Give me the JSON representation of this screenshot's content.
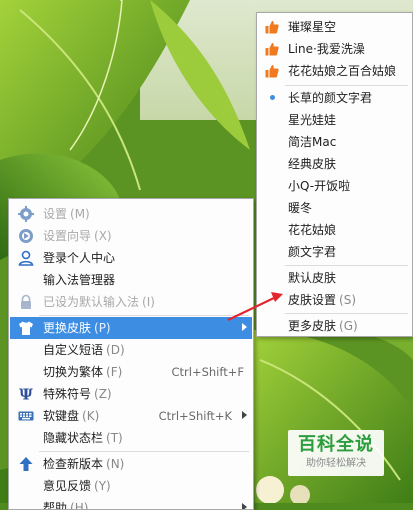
{
  "main_menu": {
    "items": [
      {
        "label": "设置",
        "hotkey": "(M)",
        "icon": "gear-icon",
        "state": "disabled"
      },
      {
        "label": "设置向导",
        "hotkey": "(X)",
        "icon": "wizard-icon",
        "state": "disabled"
      },
      {
        "label": "登录个人中心",
        "hotkey": "",
        "icon": "user-icon",
        "state": "normal"
      },
      {
        "label": "输入法管理器",
        "hotkey": "",
        "icon": "",
        "state": "normal"
      },
      {
        "label": "已设为默认输入法",
        "hotkey": "(I)",
        "icon": "lock-icon",
        "state": "disabled"
      },
      {
        "label": "更换皮肤",
        "hotkey": "(P)",
        "icon": "shirt-icon",
        "state": "highlighted",
        "submenu": true
      },
      {
        "label": "自定义短语",
        "hotkey": "(D)",
        "icon": "",
        "state": "normal"
      },
      {
        "label": "切换为繁体",
        "hotkey": "(F)",
        "icon": "",
        "state": "normal",
        "shortcut": "Ctrl+Shift+F"
      },
      {
        "label": "特殊符号",
        "hotkey": "(Z)",
        "icon": "psi-icon",
        "state": "normal"
      },
      {
        "label": "软键盘",
        "hotkey": "(K)",
        "icon": "keyboard-icon",
        "state": "normal",
        "shortcut": "Ctrl+Shift+K",
        "submenu": true
      },
      {
        "label": "隐藏状态栏",
        "hotkey": "(T)",
        "icon": "",
        "state": "normal"
      },
      {
        "label": "检查新版本",
        "hotkey": "(N)",
        "icon": "up-arrow-icon",
        "state": "normal"
      },
      {
        "label": "意见反馈",
        "hotkey": "(Y)",
        "icon": "",
        "state": "normal"
      },
      {
        "label": "帮助",
        "hotkey": "(H)",
        "icon": "",
        "state": "normal",
        "submenu": true
      }
    ]
  },
  "skin_menu": {
    "hot_items": [
      {
        "label": "璀璨星空",
        "icon": "thumbs-up-icon"
      },
      {
        "label": "Line·我爱洗澡",
        "icon": "thumbs-up-icon"
      },
      {
        "label": "花花姑娘之百合姑娘",
        "icon": "thumbs-up-icon"
      }
    ],
    "skins": [
      {
        "label": "长草的颜文字君",
        "selected": true
      },
      {
        "label": "星光娃娃",
        "selected": false
      },
      {
        "label": "简洁Mac",
        "selected": false
      },
      {
        "label": "经典皮肤",
        "selected": false
      },
      {
        "label": "小Q-开饭啦",
        "selected": false
      },
      {
        "label": "暖冬",
        "selected": false
      },
      {
        "label": "花花姑娘",
        "selected": false
      },
      {
        "label": "颜文字君",
        "selected": false
      }
    ],
    "default_skin": "默认皮肤",
    "skin_settings": {
      "label": "皮肤设置",
      "hotkey": "(S)"
    },
    "more_skins": {
      "label": "更多皮肤",
      "hotkey": "(G)"
    }
  },
  "watermark": {
    "title": "百科全说",
    "subtitle": "助你轻松解决"
  },
  "colors": {
    "highlight": "#3d8ee3",
    "thumbs": "#f07a1d",
    "annotation_arrow": "#e3262d",
    "watermark_green": "#2c9d3c"
  }
}
